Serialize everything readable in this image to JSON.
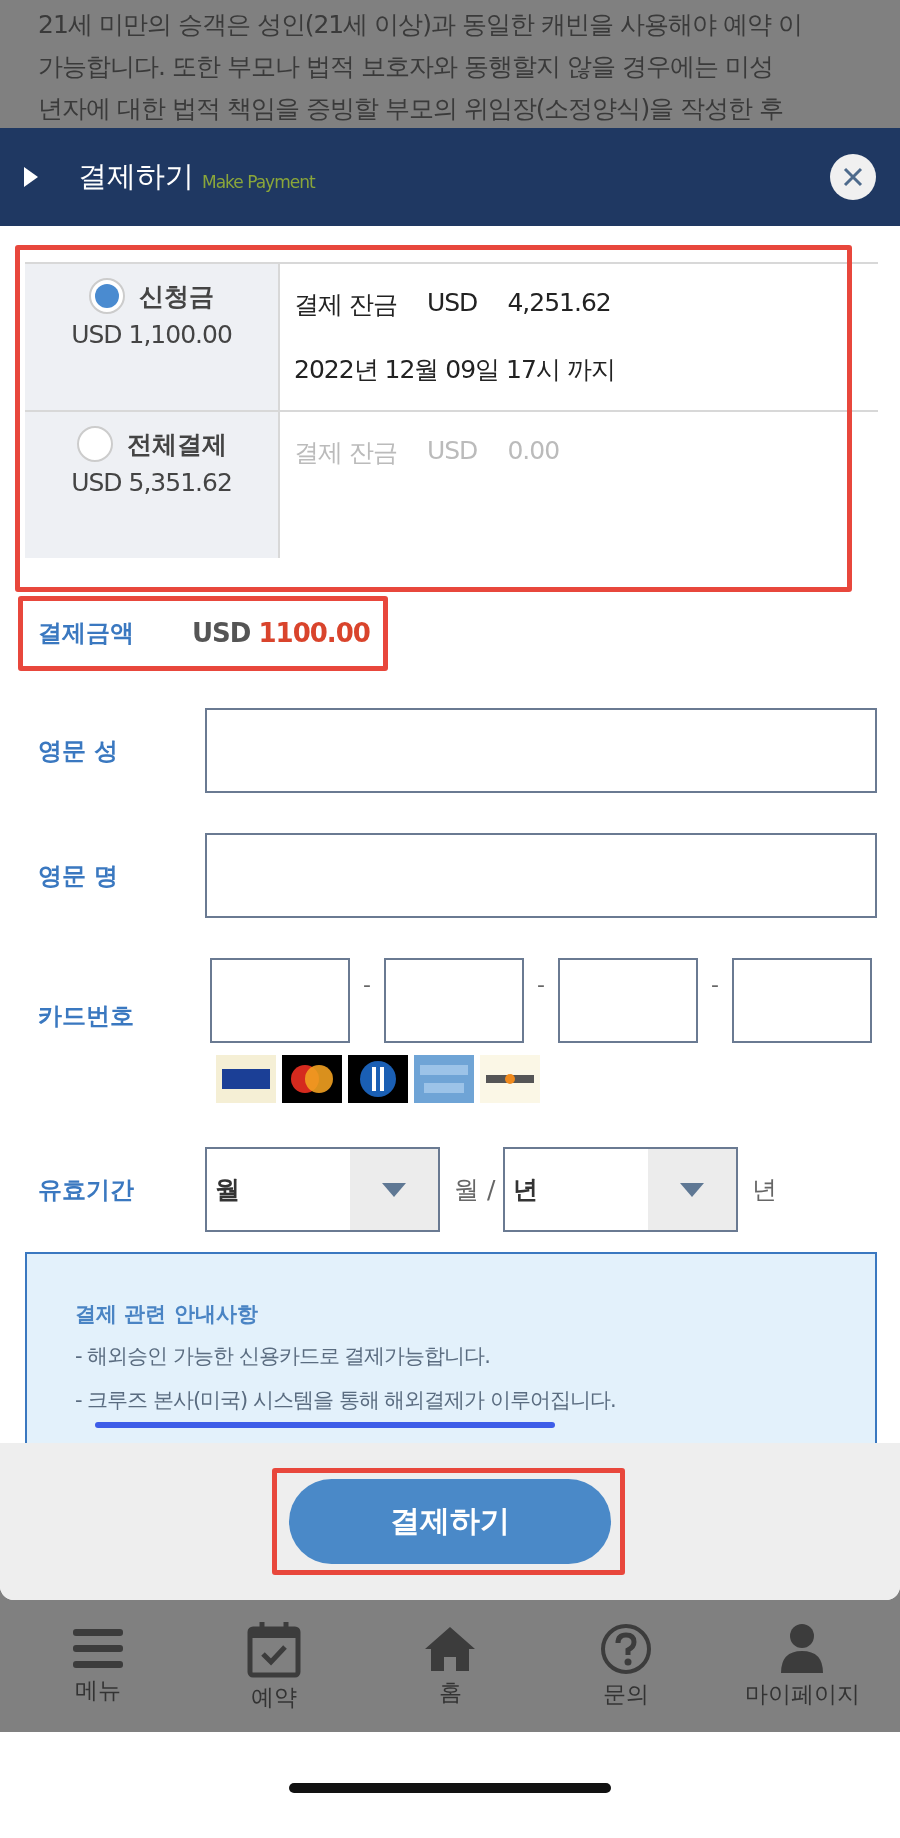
{
  "background_text_lines": [
    "21세 미만의 승객은 성인(21세 이상)과 동일한 캐빈을 사용해야 예약 이",
    "가능합니다. 또한 부모나 법적 보호자와 동행할지 않을 경우에는 미성",
    "년자에 대한 법적 책임을 증빙할 부모의 위임장(소정양식)을 작성한 후"
  ],
  "dialog": {
    "title": "결제하기",
    "subtitle": "Make Payment"
  },
  "payment_options": [
    {
      "label": "신청금",
      "amount": "USD 1,100.00",
      "selected": true,
      "balance_label": "결제 잔금",
      "balance_currency": "USD",
      "balance_amount": "4,251.62",
      "deadline": "2022년 12월 09일 17시 까지"
    },
    {
      "label": "전체결제",
      "amount": "USD 5,351.62",
      "selected": false,
      "balance_label": "결제 잔금",
      "balance_currency": "USD",
      "balance_amount": "0.00"
    }
  ],
  "total": {
    "label": "결제금액",
    "currency": "USD",
    "amount": "1100.00"
  },
  "name_fields": [
    {
      "label": "영문 성"
    },
    {
      "label": "영문 명"
    }
  ],
  "card_number": {
    "label": "카드번호",
    "separators": [
      "-",
      "-",
      "-"
    ]
  },
  "expiry": {
    "label": "유효기간",
    "month": {
      "value": "월",
      "suffix": "월 /"
    },
    "year": {
      "value": "년",
      "suffix": "년"
    }
  },
  "notice": {
    "title": "결제 관련 안내사항",
    "lines": [
      "- 해외승인 가능한 신용카드로 결제가능합니다.",
      "- 크루즈 본사(미국) 시스템을 통해 해외결제가 이루어집니다."
    ]
  },
  "submit_button": "결제하기",
  "nav_items": [
    {
      "kind": "menu",
      "label": "메뉴"
    },
    {
      "kind": "calendar",
      "label": "예약"
    },
    {
      "kind": "home",
      "label": "홈"
    },
    {
      "kind": "help",
      "label": "문의"
    },
    {
      "kind": "person",
      "label": "마이페이지"
    }
  ]
}
